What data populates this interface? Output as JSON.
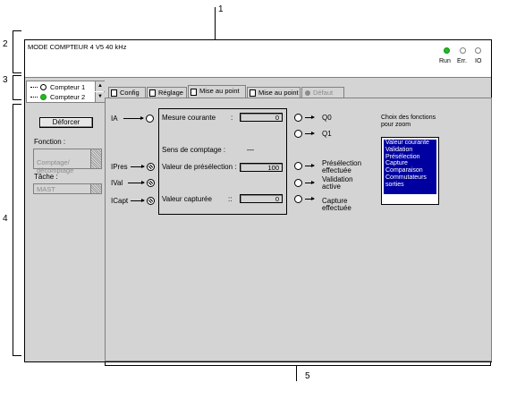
{
  "callouts": {
    "c1": "1",
    "c2": "2",
    "c3": "3",
    "c4": "4",
    "c5": "5"
  },
  "window": {
    "title": "MODE COMPTEUR 4 V5 40 kHz"
  },
  "status": {
    "run": "Run",
    "err": "Err.",
    "io": "IO",
    "colors": {
      "run": "#22bb22",
      "err": "#ffffff",
      "io": "#ffffff"
    }
  },
  "counters": {
    "items": [
      "Compteur 1",
      "Compteur 2"
    ]
  },
  "tabs": [
    "Config",
    "Réglage",
    "Mise au point",
    "Mise au point",
    "Défaut"
  ],
  "left": {
    "force_button": "Déforcer",
    "function_label": "Fonction :",
    "function_value": "Comptage/\ndécomptage",
    "task_label": "Tâche :",
    "task_value": "MAST"
  },
  "inputs": {
    "ia": "IA",
    "ipres": "IPres",
    "ival": "IVal",
    "icapt": "ICapt"
  },
  "measures": {
    "current_label": "Mesure courante",
    "current_colon": ":",
    "current_value": "0",
    "direction_label": "Sens de comptage :",
    "direction_value": "—",
    "preset_label": "Valeur de présélection :",
    "preset_value": "100",
    "captured_label": "Valeur capturée",
    "captured_colon": "::",
    "captured_value": "0"
  },
  "outputs": {
    "q0": "Q0",
    "q1": "Q1",
    "preset_done": "Présélection\neffectuée",
    "validation": "Validation\nactive",
    "capture_done": "Capture\neffectuée"
  },
  "zoom": {
    "title": "Choix des fonctions\npour zoom",
    "items": [
      "Valeur courante",
      "Validation",
      "Présélection",
      "Capture",
      "Comparaison",
      "Commutateurs",
      "sorties"
    ]
  }
}
